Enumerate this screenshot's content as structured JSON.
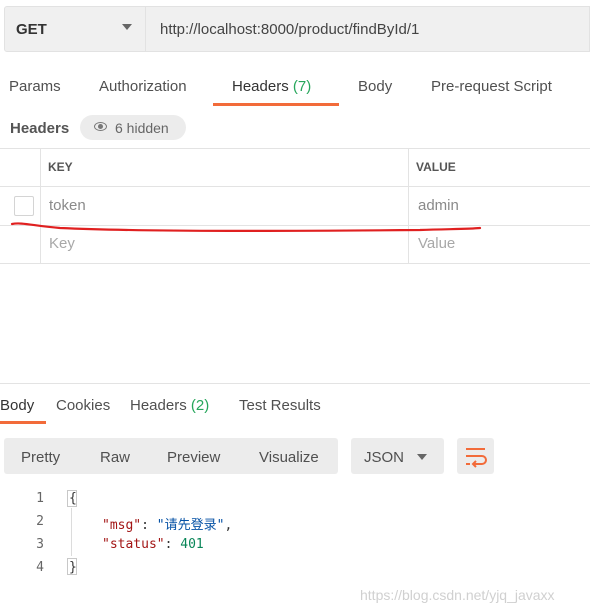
{
  "request": {
    "method": "GET",
    "url": "http://localhost:8000/product/findById/1"
  },
  "request_tabs": [
    {
      "label": "Params"
    },
    {
      "label": "Authorization"
    },
    {
      "label": "Headers",
      "count": "(7)"
    },
    {
      "label": "Body"
    },
    {
      "label": "Pre-request Script"
    }
  ],
  "headers_section": {
    "title": "Headers",
    "hidden_label": "6 hidden",
    "columns": {
      "key": "KEY",
      "value": "VALUE"
    },
    "rows": [
      {
        "key": "token",
        "value": "admin"
      }
    ],
    "placeholder": {
      "key": "Key",
      "value": "Value"
    }
  },
  "response_tabs": [
    {
      "label": "Body"
    },
    {
      "label": "Cookies"
    },
    {
      "label": "Headers",
      "count": "(2)"
    },
    {
      "label": "Test Results"
    }
  ],
  "view_modes": [
    "Pretty",
    "Raw",
    "Preview",
    "Visualize"
  ],
  "format": "JSON",
  "code": {
    "line_numbers": [
      "1",
      "2",
      "3",
      "4"
    ],
    "open_brace": "{",
    "close_brace": "}",
    "msg_key": "\"msg\"",
    "msg_value": "\"请先登录\"",
    "status_key": "\"status\"",
    "status_value": "401"
  },
  "watermark": "https://blog.csdn.net/yjq_javaxx",
  "colors": {
    "accent": "#f26b3a",
    "count_green": "#26a65b",
    "annotation_red": "#e02020"
  },
  "icons": [
    "chevron-down-icon",
    "eye-icon",
    "wrap-lines-icon"
  ]
}
